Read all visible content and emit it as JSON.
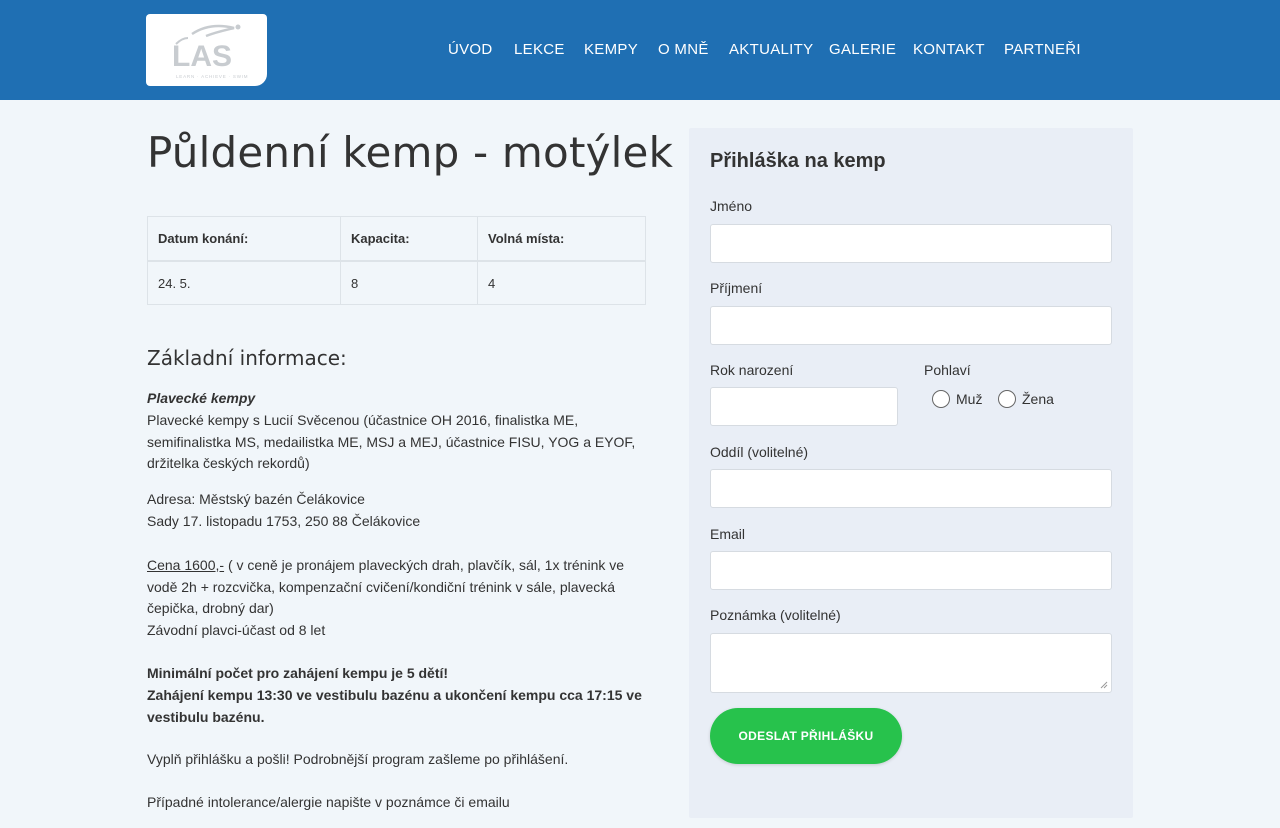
{
  "logo": {
    "text": "LAS",
    "tagline": "LEARN · ACHIEVE · SWIM"
  },
  "nav": [
    "ÚVOD",
    "LEKCE",
    "KEMPY",
    "O MNĚ",
    "AKTUALITY",
    "GALERIE",
    "KONTAKT",
    "PARTNEŘI"
  ],
  "page": {
    "title": "Půldenní kemp - motýlek"
  },
  "info_table": {
    "headers": [
      "Datum konání:",
      "Kapacita:",
      "Volná místa:"
    ],
    "row": [
      "24. 5.",
      "8",
      "4"
    ]
  },
  "section": {
    "heading": "Základní informace:",
    "camp_title": "Plavecké kempy",
    "intro": "Plavecké kempy s Lucií Svěcenou (účastnice OH 2016, finalistka ME, semifinalistka MS, medailistka ME, MSJ a MEJ, účastnice FISU, YOG a EYOF, držitelka českých rekordů)",
    "address_line1": "Adresa: Městský bazén Čelákovice",
    "address_line2": "Sady 17. listopadu 1753, 250 88 Čelákovice",
    "price": "Cena 1600,-",
    "price_detail": " ( v ceně je pronájem plaveckých drah, plavčík, sál, 1x trénink ve vodě 2h + rozcvička, kompenzační cvičení/kondiční trénink v sále, plavecká čepička, drobný dar)",
    "competitors": "Závodní plavci-účast od 8 let",
    "min_count": "Minimální počet pro zahájení kempu je 5 dětí!",
    "start_info": "Zahájení kempu 13:30 ve vestibulu bazénu a ukončení kempu cca 17:15 ve vestibulu bazénu.",
    "fill_form": "Vyplň přihlášku a pošli! Podrobnější program zašleme po přihlášení.",
    "allergies": "Případné intolerance/alergie napište v poznámce či emailu"
  },
  "form": {
    "title": "Přihláška na kemp",
    "first_name_label": "Jméno",
    "last_name_label": "Příjmení",
    "birth_year_label": "Rok narození",
    "gender_label": "Pohlaví",
    "gender_male": "Muž",
    "gender_female": "Žena",
    "club_label": "Oddíl (volitelné)",
    "email_label": "Email",
    "note_label": "Poznámka (volitelné)",
    "submit_label": "ODESLAT PŘIHLÁŠKU"
  },
  "colors": {
    "header": "#1f6fb3",
    "submit": "#27c24c",
    "panel": "#e9eef6",
    "page": "#f1f6fa"
  }
}
